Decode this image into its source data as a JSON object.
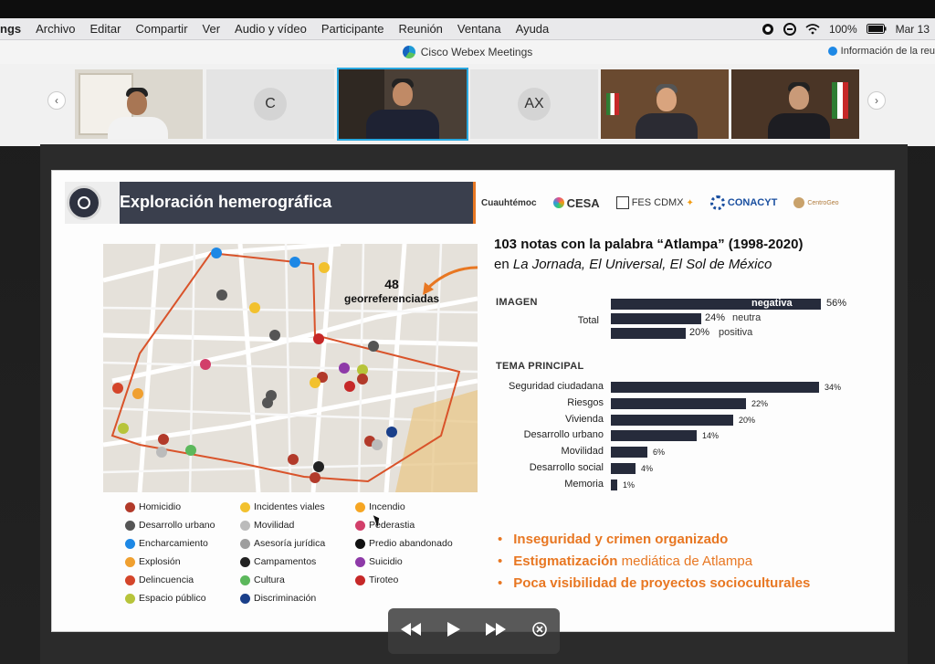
{
  "menubar": {
    "app_name": "ngs",
    "items": [
      "Archivo",
      "Editar",
      "Compartir",
      "Ver",
      "Audio y vídeo",
      "Participante",
      "Reunión",
      "Ventana",
      "Ayuda"
    ],
    "battery": "100%",
    "clock": "Mar 13"
  },
  "window": {
    "title": "Cisco Webex Meetings",
    "meeting_info": "Información de la reu"
  },
  "participants": {
    "tiles": [
      {
        "initials": ""
      },
      {
        "initials": "C"
      },
      {
        "initials": ""
      },
      {
        "initials": "AX"
      },
      {
        "initials": ""
      },
      {
        "initials": ""
      }
    ]
  },
  "slide": {
    "title": "Exploración hemerográfica",
    "logos": {
      "cuauhtemoc": "Cuauhtémoc",
      "cesa": "CESA",
      "fes": "FES CDMX",
      "conacyt": "CONACYT",
      "centrogeo": "CentroGeo"
    },
    "callout": {
      "count": "48",
      "label": "georreferenciadas"
    },
    "heading": {
      "line1": "103 notas con la palabra “Atlampa” (1998-2020)",
      "line2_prefix": "en ",
      "line2_sources": "La Jornada, El Universal, El Sol de México"
    },
    "imagen": {
      "section": "IMAGEN",
      "total_label": "Total",
      "bars": [
        {
          "label": "negativa",
          "pct": "56%",
          "value": 56
        },
        {
          "label": "neutra",
          "pct": "24%",
          "value": 24
        },
        {
          "label": "positiva",
          "pct": "20%",
          "value": 20
        }
      ]
    },
    "tema": {
      "section": "TEMA PRINCIPAL",
      "bars": [
        {
          "label": "Seguridad ciudadana",
          "pct": "34%",
          "value": 34
        },
        {
          "label": "Riesgos",
          "pct": "22%",
          "value": 22
        },
        {
          "label": "Vivienda",
          "pct": "20%",
          "value": 20
        },
        {
          "label": "Desarrollo urbano",
          "pct": "14%",
          "value": 14
        },
        {
          "label": "Movilidad",
          "pct": "6%",
          "value": 6
        },
        {
          "label": "Desarrollo social",
          "pct": "4%",
          "value": 4
        },
        {
          "label": "Memoria",
          "pct": "1%",
          "value": 1
        }
      ]
    },
    "legend": {
      "col1": [
        {
          "label": "Homicidio",
          "color": "#b23a2a"
        },
        {
          "label": "Desarrollo urbano",
          "color": "#555555"
        },
        {
          "label": "Encharcamiento",
          "color": "#1e88e5"
        },
        {
          "label": "Explosión",
          "color": "#f0a030"
        },
        {
          "label": "Delincuencia",
          "color": "#d4452a"
        },
        {
          "label": "Espacio público",
          "color": "#b7c43a"
        }
      ],
      "col2": [
        {
          "label": "Incidentes viales",
          "color": "#f2c12e"
        },
        {
          "label": "Movilidad",
          "color": "#bbbbbb"
        },
        {
          "label": "Asesoría jurídica",
          "color": "#9e9e9e"
        },
        {
          "label": "Campamentos",
          "color": "#222222"
        },
        {
          "label": "Cultura",
          "color": "#5cb85c"
        },
        {
          "label": "Discriminación",
          "color": "#1a3f8a"
        }
      ],
      "col3": [
        {
          "label": "Incendio",
          "color": "#f6a623"
        },
        {
          "label": "Pederastia",
          "color": "#d23f6a"
        },
        {
          "label": "Predio abandonado",
          "color": "#111111"
        },
        {
          "label": "Suicidio",
          "color": "#8e3aa8"
        },
        {
          "label": "Tiroteo",
          "color": "#c62828"
        }
      ]
    },
    "bullets": [
      {
        "bold": "Inseguridad y crimen organizado",
        "rest": ""
      },
      {
        "bold": "Estigmatización",
        "rest": " mediática de Atlampa"
      },
      {
        "bold": "Poca visibilidad de proyectos socioculturales",
        "rest": ""
      }
    ]
  },
  "colors": {
    "accent": "#e87722",
    "bar": "#262b3b",
    "header": "#3a3f4d",
    "active_tile": "#29a8e0"
  }
}
